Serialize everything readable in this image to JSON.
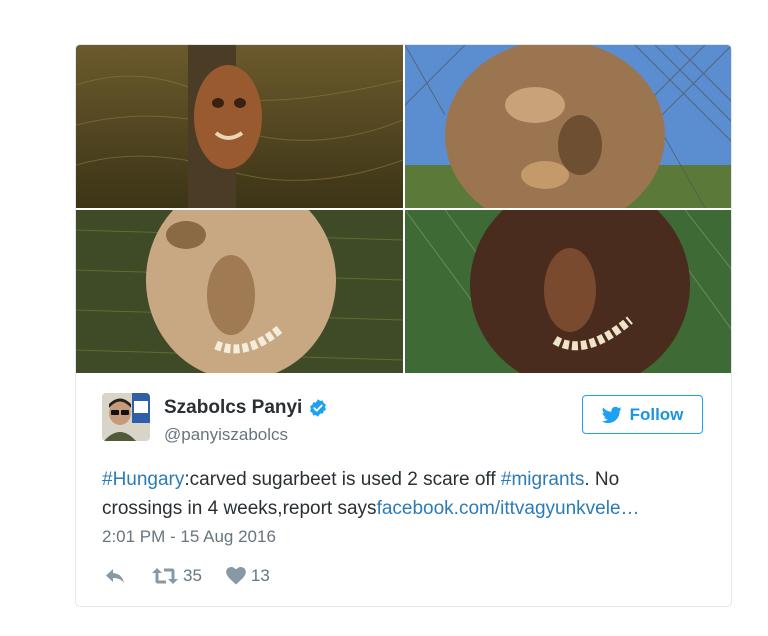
{
  "tweet": {
    "author": {
      "name": "Szabolcs Panyi",
      "handle": "@panyiszabolcs",
      "verified": true
    },
    "follow_label": "Follow",
    "text": {
      "hashtag1": "#Hungary",
      "part1": ":carved sugarbeet is used 2 scare off ",
      "hashtag2": "#migrants",
      "part2": ". No crossings in 4 weeks,report says",
      "link": "facebook.com/ittvagyunkvele…"
    },
    "timestamp": "2:01 PM - 15 Aug 2016",
    "stats": {
      "retweets": "35",
      "likes": "13"
    },
    "media": [
      {
        "subject": "carved sugarbeet face on fence post, barbed wire"
      },
      {
        "subject": "carved sugarbeet face close-up, chain-link fence and sky"
      },
      {
        "subject": "carved sugarbeet face with teeth, grass background"
      },
      {
        "subject": "carved sugarbeet face with teeth, chain-link fence"
      }
    ],
    "colors": {
      "accent": "#1da1f2",
      "link": "#2b7bb9",
      "text": "#292f33",
      "muted": "#66757f",
      "icon": "#8899a6"
    }
  }
}
